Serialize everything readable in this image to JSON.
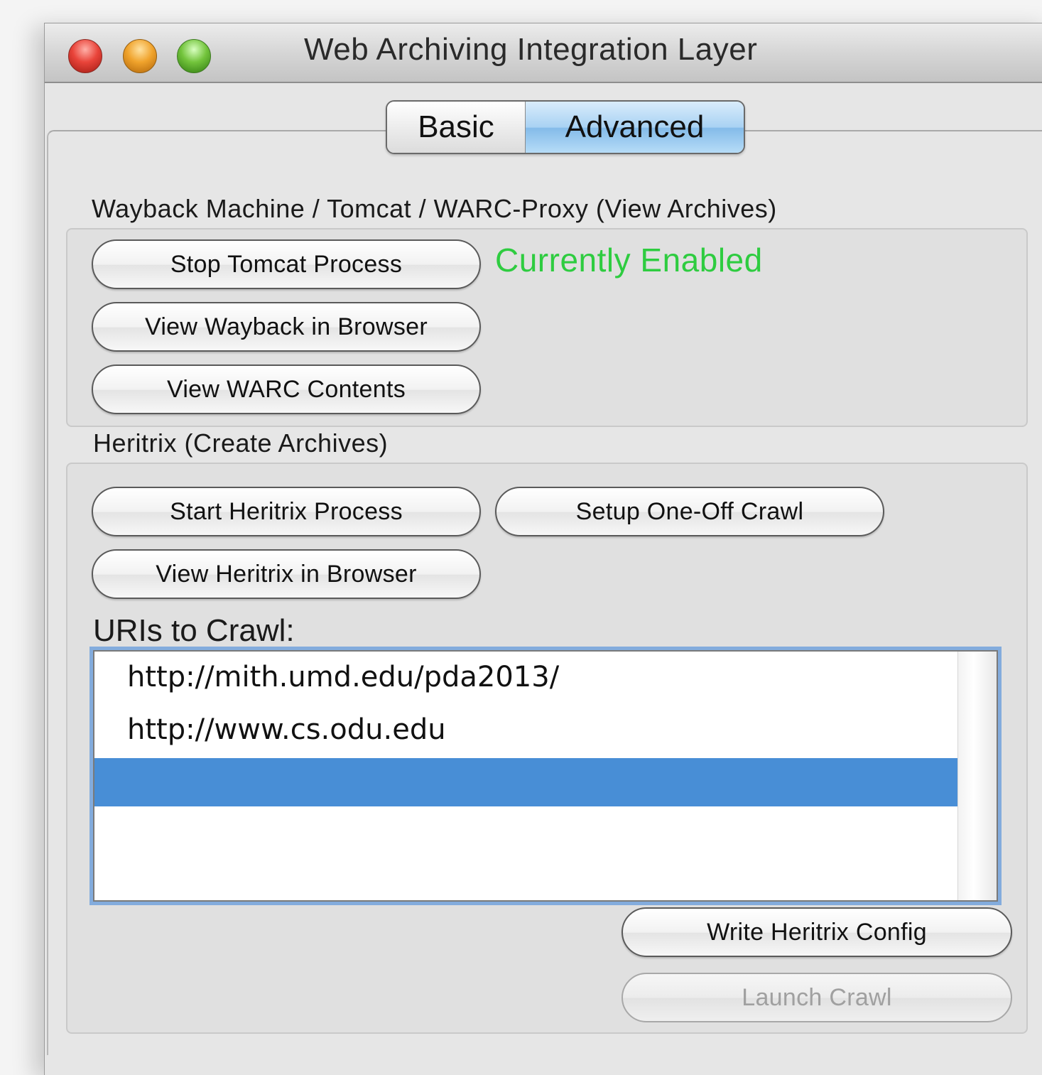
{
  "window": {
    "title": "Web Archiving Integration Layer"
  },
  "tabs": [
    {
      "label": "Basic",
      "selected": false
    },
    {
      "label": "Advanced",
      "selected": true
    }
  ],
  "wayback": {
    "label": "Wayback Machine / Tomcat / WARC-Proxy (View Archives)",
    "stop_button": "Stop Tomcat Process",
    "status": "Currently Enabled",
    "status_color": "#2ecc40",
    "view_wayback_button": "View Wayback in Browser",
    "view_warc_button": "View WARC Contents"
  },
  "heritrix": {
    "label": "Heritrix (Create Archives)",
    "start_button": "Start Heritrix Process",
    "setup_button": "Setup One-Off Crawl",
    "view_button": "View Heritrix in Browser",
    "uris_label": "URIs to Crawl:",
    "uris": [
      "http://mith.umd.edu/pda2013/",
      "http://www.cs.odu.edu",
      ""
    ],
    "selected_uri_index": 2,
    "write_config_button": "Write Heritrix Config",
    "launch_button": "Launch Crawl",
    "launch_enabled": false
  }
}
